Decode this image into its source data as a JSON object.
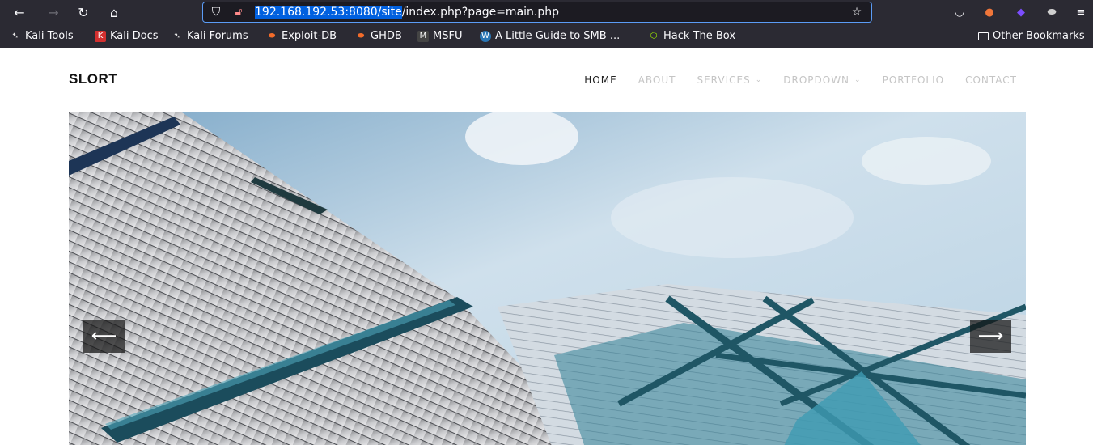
{
  "browser": {
    "url_selected": "192.168.192.53:8080/site",
    "url_rest": "/index.php?page=main.php",
    "icons": {
      "back": "back-arrow-icon",
      "forward": "forward-arrow-icon",
      "reload": "reload-icon",
      "home": "home-icon",
      "shield": "shield-icon",
      "lock": "lock-icon",
      "star": "star-icon",
      "pocket": "pocket-icon",
      "menu": "hamburger-menu-icon"
    },
    "bookmarks": [
      {
        "label": "Kali Tools",
        "icon": "kali-icon"
      },
      {
        "label": "Kali Docs",
        "icon": "kali-docs-icon"
      },
      {
        "label": "Kali Forums",
        "icon": "kali-icon"
      },
      {
        "label": "Exploit-DB",
        "icon": "exploit-db-icon"
      },
      {
        "label": "GHDB",
        "icon": "ghdb-icon"
      },
      {
        "label": "MSFU",
        "icon": "msfu-icon"
      },
      {
        "label": "A Little Guide to SMB ...",
        "icon": "wordpress-icon"
      },
      {
        "label": "Hack The Box",
        "icon": "hackthebox-icon"
      }
    ],
    "other_bookmarks": "Other Bookmarks"
  },
  "site": {
    "logo": "SLORT",
    "menu": [
      {
        "label": "HOME",
        "active": true,
        "dropdown": false
      },
      {
        "label": "ABOUT",
        "active": false,
        "dropdown": false
      },
      {
        "label": "SERVICES",
        "active": false,
        "dropdown": true
      },
      {
        "label": "DROPDOWN",
        "active": false,
        "dropdown": true
      },
      {
        "label": "PORTFOLIO",
        "active": false,
        "dropdown": false
      },
      {
        "label": "CONTACT",
        "active": false,
        "dropdown": false
      }
    ],
    "carousel": {
      "prev_icon": "arrow-left-icon",
      "next_icon": "arrow-right-icon"
    }
  },
  "colors": {
    "chrome_bg": "#2b2a33",
    "url_highlight": "#0060df",
    "accent_focus": "#5b9cf6"
  }
}
